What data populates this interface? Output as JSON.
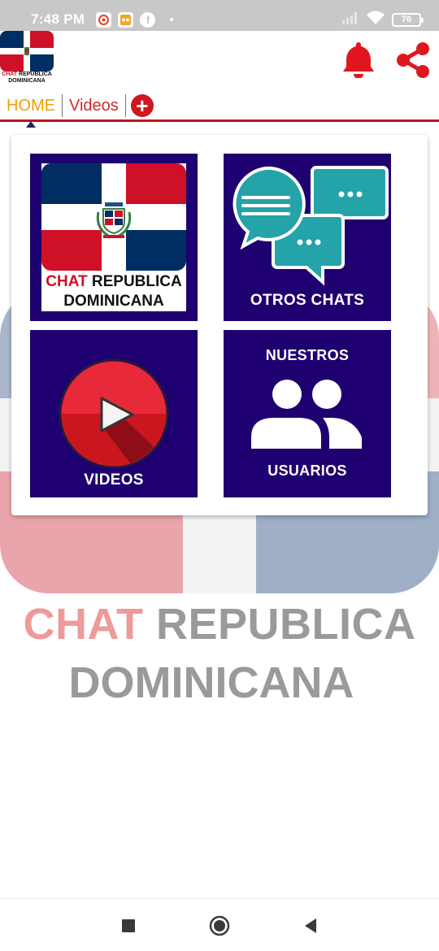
{
  "status_bar": {
    "time": "7:48 PM",
    "battery": "76",
    "notification_icons": [
      "gallery-icon",
      "game-icon",
      "facebook-icon"
    ],
    "signal_icons": [
      "signal-icon",
      "wifi-icon",
      "battery-icon"
    ]
  },
  "header": {
    "logo_text_red": "CHAT",
    "logo_text_rest": " REPUBLICA",
    "logo_text_line2": "DOMINICANA",
    "actions": [
      "bell-icon",
      "share-icon"
    ]
  },
  "tabs": {
    "items": [
      {
        "label": "HOME",
        "active": true
      },
      {
        "label": "Videos",
        "active": false
      }
    ],
    "add_icon": "plus-circle-icon"
  },
  "tiles": {
    "chat_rd": {
      "line1_red": "CHAT",
      "line1_rest": " REPUBLICA",
      "line2": "DOMINICANA"
    },
    "otros_chats": {
      "label": "OTROS CHATS"
    },
    "videos": {
      "label": "VIDEOS"
    },
    "usuarios": {
      "label_top": "NUESTROS",
      "label_bottom": "USUARIOS"
    }
  },
  "background": {
    "line1_red": "CHAT",
    "line1_rest": " REPUBLICA",
    "line2": "DOMINICANA"
  },
  "colors": {
    "tile_bg": "#1f0070",
    "accent_red": "#ce1126",
    "flag_blue": "#002d62",
    "tab_active": "#f0a100",
    "chat_bubble": "#24a3a8"
  },
  "nav_bar": {
    "buttons": [
      "recents-square-icon",
      "home-circle-icon",
      "back-triangle-icon"
    ]
  }
}
